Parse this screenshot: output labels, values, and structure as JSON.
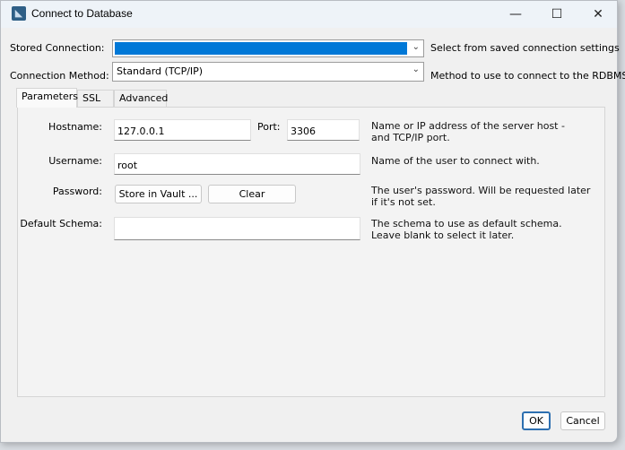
{
  "window": {
    "title": "Connect to Database",
    "controls": {
      "minimize": "—",
      "maximize": "☐",
      "close": "✕"
    }
  },
  "stored_connection": {
    "label": "Stored Connection:",
    "value": "",
    "help": "Select from saved connection settings"
  },
  "connection_method": {
    "label": "Connection Method:",
    "value": "Standard (TCP/IP)",
    "help": "Method to use to connect to the RDBMS"
  },
  "tabs": [
    {
      "label": "Parameters"
    },
    {
      "label": "SSL"
    },
    {
      "label": "Advanced"
    }
  ],
  "parameters": {
    "hostname": {
      "label": "Hostname:",
      "value": "127.0.0.1"
    },
    "port": {
      "label": "Port:",
      "value": "3306"
    },
    "hostname_help": "Name or IP address of the server host - and TCP/IP port.",
    "username": {
      "label": "Username:",
      "value": "root",
      "help": "Name of the user to connect with."
    },
    "password": {
      "label": "Password:",
      "store_button": "Store in Vault ...",
      "clear_button": "Clear",
      "help": "The user's password. Will be requested later if it's not set."
    },
    "default_schema": {
      "label": "Default Schema:",
      "value": "",
      "help": "The schema to use as default schema. Leave blank to select it later."
    }
  },
  "footer": {
    "ok": "OK",
    "cancel": "Cancel"
  }
}
